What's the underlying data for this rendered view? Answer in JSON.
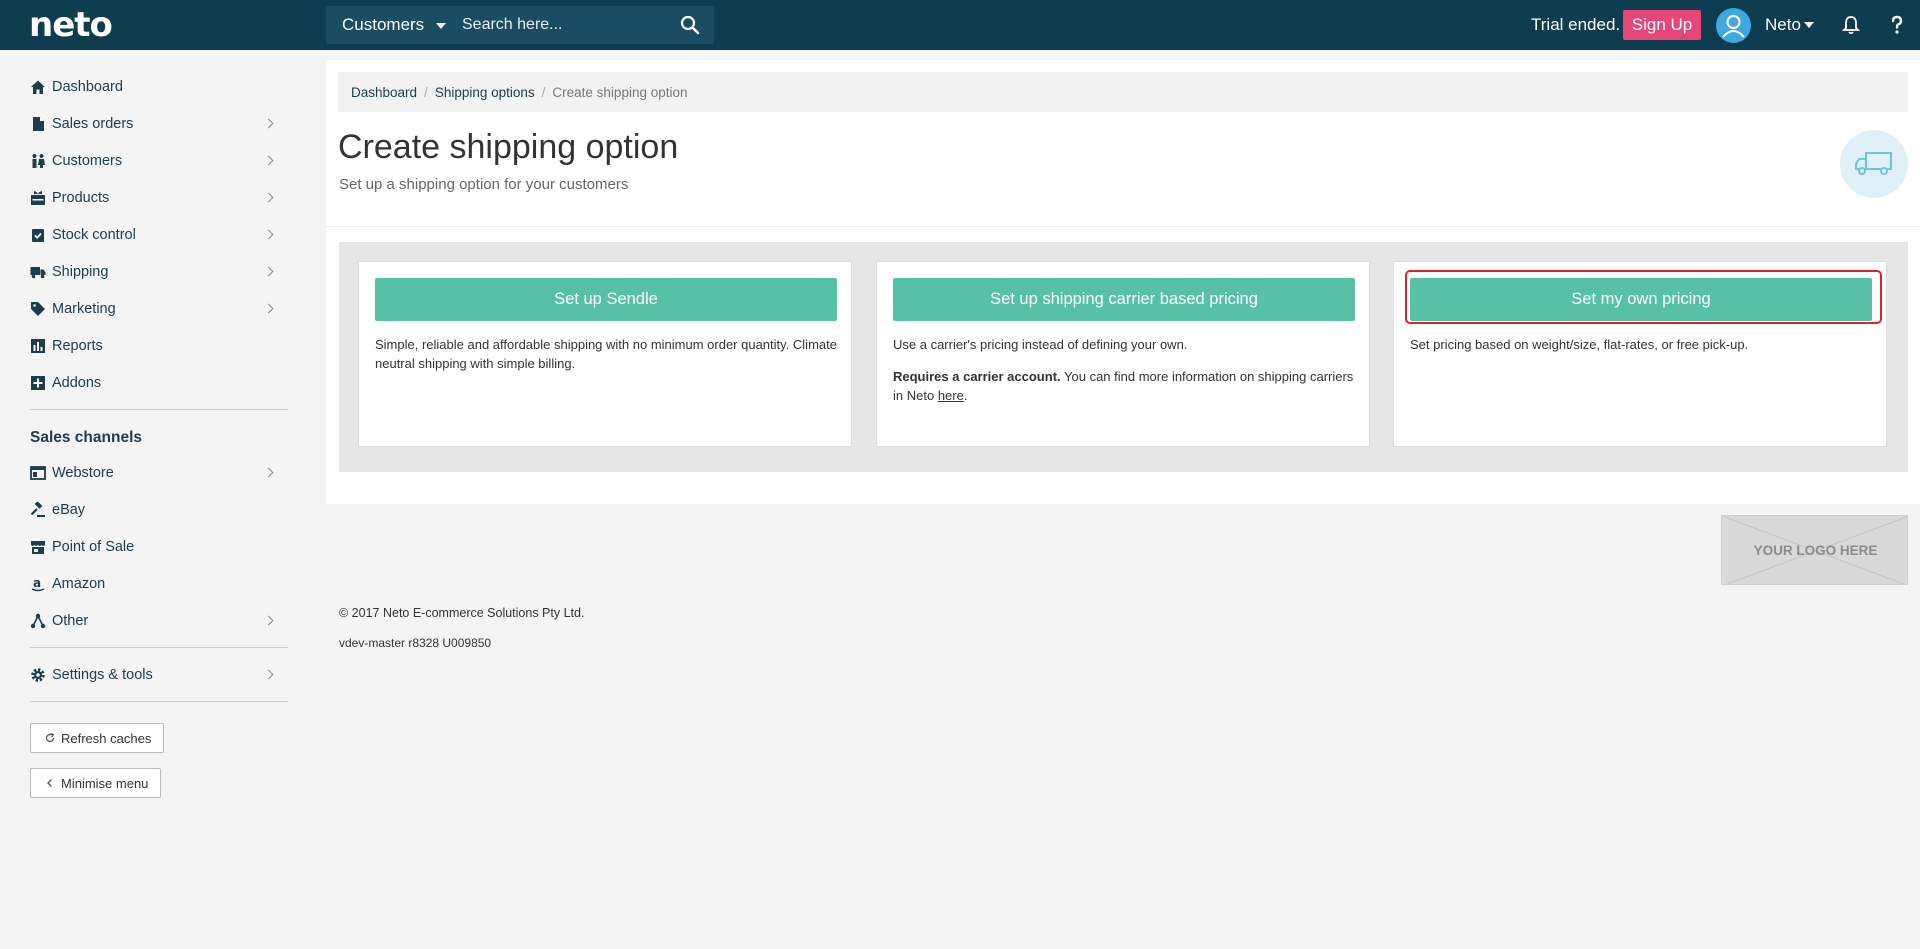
{
  "header": {
    "logo": "neto",
    "search_scope": "Customers",
    "search_placeholder": "Search here...",
    "trial_text": "Trial ended.",
    "signup_label": "Sign Up",
    "user_name": "Neto",
    "colors": {
      "bar": "#0e3d4f",
      "signup": "#e8467a",
      "avatar": "#3fa9df"
    }
  },
  "sidebar": {
    "items": [
      {
        "label": "Dashboard",
        "icon": "home-icon",
        "chevron": false
      },
      {
        "label": "Sales orders",
        "icon": "document-icon",
        "chevron": true
      },
      {
        "label": "Customers",
        "icon": "people-icon",
        "chevron": true
      },
      {
        "label": "Products",
        "icon": "gift-icon",
        "chevron": true
      },
      {
        "label": "Stock control",
        "icon": "clipboard-check-icon",
        "chevron": true
      },
      {
        "label": "Shipping",
        "icon": "truck-icon",
        "chevron": true
      },
      {
        "label": "Marketing",
        "icon": "tag-icon",
        "chevron": true
      },
      {
        "label": "Reports",
        "icon": "bar-chart-icon",
        "chevron": false
      },
      {
        "label": "Addons",
        "icon": "plus-square-icon",
        "chevron": false
      }
    ],
    "channels_title": "Sales channels",
    "channels": [
      {
        "label": "Webstore",
        "icon": "browser-icon",
        "chevron": true
      },
      {
        "label": "eBay",
        "icon": "gavel-icon",
        "chevron": false
      },
      {
        "label": "Point of Sale",
        "icon": "store-icon",
        "chevron": false
      },
      {
        "label": "Amazon",
        "icon": "amazon-icon",
        "chevron": false
      },
      {
        "label": "Other",
        "icon": "network-icon",
        "chevron": true
      }
    ],
    "settings": {
      "label": "Settings & tools",
      "icon": "gear-icon",
      "chevron": true
    },
    "refresh_label": "Refresh caches",
    "minimise_label": "Minimise menu"
  },
  "breadcrumb": {
    "dashboard": "Dashboard",
    "shipping_options": "Shipping options",
    "current": "Create shipping option"
  },
  "page": {
    "title": "Create shipping option",
    "subtitle": "Set up a shipping option for your customers"
  },
  "cards": [
    {
      "button": "Set up Sendle",
      "text": "Simple, reliable and affordable shipping with no minimum order quantity. Climate neutral shipping with simple billing."
    },
    {
      "button": "Set up shipping carrier based pricing",
      "text": "Use a carrier's pricing instead of defining your own.",
      "bold": "Requires a carrier account.",
      "text2": " You can find more information on shipping carriers in Neto ",
      "link": "here",
      "text3": "."
    },
    {
      "button": "Set my own pricing",
      "text": "Set pricing based on weight/size, flat-rates, or free pick-up."
    }
  ],
  "accent_color": "#56c1a6",
  "footer": {
    "logo_placeholder": "YOUR LOGO HERE",
    "copyright": "© 2017 Neto E-commerce Solutions Pty Ltd.",
    "version": "vdev-master r8328 U009850"
  }
}
